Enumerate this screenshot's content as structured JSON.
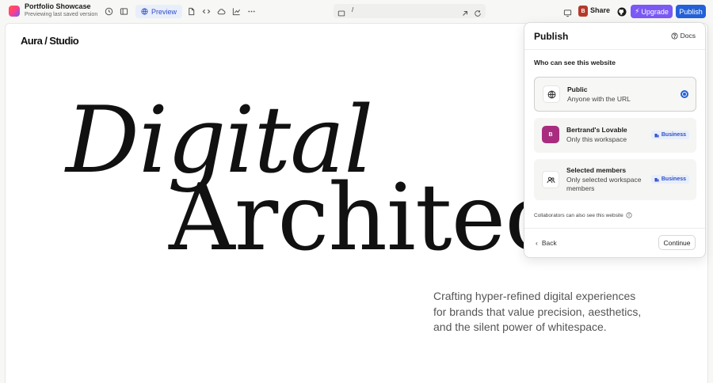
{
  "project": {
    "name": "Portfolio Showcase",
    "subtitle": "Previewing last saved version"
  },
  "toolbar": {
    "preview_label": "Preview",
    "url_path": "/",
    "share_avatar": "B",
    "share_label": "Share",
    "upgrade_label": "Upgrade",
    "publish_label": "Publish"
  },
  "site": {
    "brand": "Aura / Studio",
    "hero_line1": "Digital",
    "hero_line2": "Architect.",
    "tagline": "Crafting hyper-refined digital experiences for brands that value precision, aesthetics, and the silent power of whitespace."
  },
  "publish_panel": {
    "title": "Publish",
    "docs_label": "Docs",
    "section_label": "Who can see this website",
    "options": [
      {
        "title": "Public",
        "subtitle": "Anyone with the URL",
        "icon": "globe-icon",
        "selected": true
      },
      {
        "title": "Bertrand's Lovable",
        "subtitle": "Only this workspace",
        "avatar": "B",
        "badge": "Business"
      },
      {
        "title": "Selected members",
        "subtitle": "Only selected workspace members",
        "icon": "users-icon",
        "badge": "Business"
      }
    ],
    "collab_note": "Collaborators can also see this website",
    "back_label": "Back",
    "continue_label": "Continue"
  },
  "colors": {
    "accent_blue": "#2361d8",
    "upgrade_purple": "#7b59f5",
    "workspace_avatar": "#a92d7e",
    "badge_bg": "#e8eefb"
  }
}
